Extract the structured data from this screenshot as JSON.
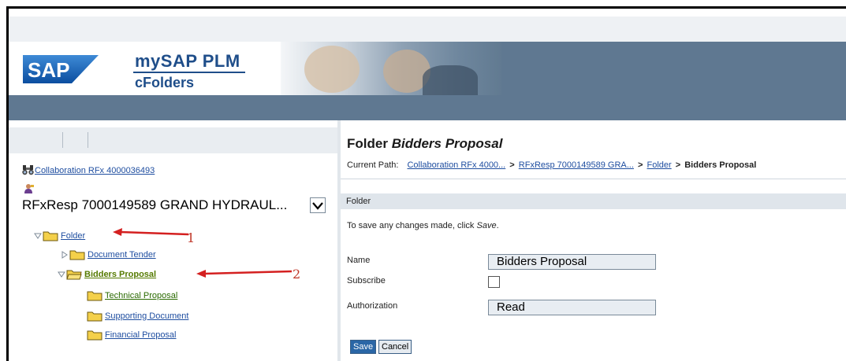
{
  "brand": {
    "logo": "SAP",
    "title": "mySAP PLM",
    "subtitle": "cFolders"
  },
  "tree": {
    "collaboration": "Collaboration RFx 4000036493",
    "rfx": "RFxResp 7000149589 GRAND HYDRAUL...",
    "items": [
      {
        "label": "Folder",
        "expanded": true
      },
      {
        "label": "Document Tender",
        "expanded": false
      },
      {
        "label": "Bidders Proposal",
        "expanded": true,
        "selected": true
      },
      {
        "label": "Technical Proposal"
      },
      {
        "label": "Supporting Document"
      },
      {
        "label": "Financial Proposal"
      }
    ]
  },
  "annotations": {
    "one": "1",
    "two": "2"
  },
  "detail": {
    "title_prefix": "Folder",
    "title_name": "Bidders Proposal",
    "path_label": "Current Path:",
    "path": [
      "Collaboration RFx 4000...",
      "RFxResp 7000149589 GRA...",
      "Folder"
    ],
    "path_sep": ">",
    "path_current": "Bidders Proposal",
    "section": "Folder",
    "hint_text": "To save any changes made, click",
    "hint_action": "Save",
    "hint_end": ".",
    "fields": {
      "name_label": "Name",
      "name_value": "Bidders Proposal",
      "subscribe_label": "Subscribe",
      "subscribe_checked": false,
      "auth_label": "Authorization",
      "auth_value": "Read"
    },
    "buttons": {
      "save": "Save",
      "cancel": "Cancel"
    }
  },
  "colors": {
    "brand_blue": "#1f4e8a",
    "nav_bar": "#5f7891",
    "link": "#1f4ea0",
    "annotation_red": "#d42020"
  }
}
